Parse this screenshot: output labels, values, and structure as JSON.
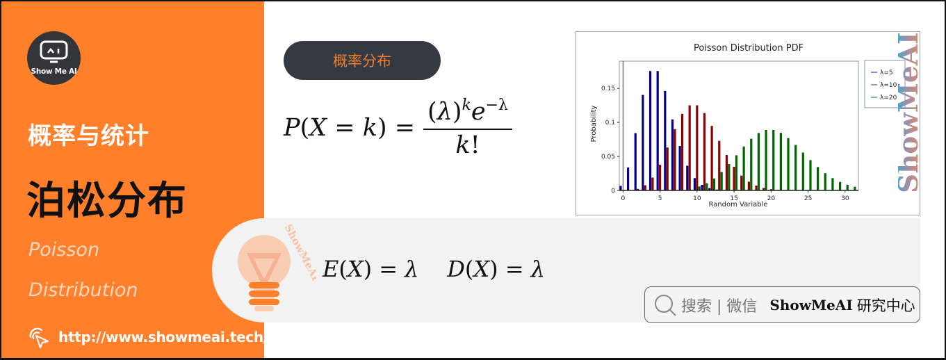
{
  "brand": {
    "logo_text": "Show Me AI",
    "logo_glyph": "^ I",
    "url": "http://www.showmeai.tech/",
    "watermark": "ShowMeAI"
  },
  "left_panel": {
    "subject": "概率与统计",
    "title_cn": "泊松分布",
    "title_en_line1": "Poisson",
    "title_en_line2": "Distribution"
  },
  "colors": {
    "orange": "#FF7F2A",
    "dark": "#343A44",
    "band_gray": "#F2F2F2",
    "lambda5": "#00008B",
    "lambda10": "#8B0000",
    "lambda20": "#006400"
  },
  "tag": {
    "label": "概率分布"
  },
  "formula": {
    "lhs": "P(X = k) =",
    "numerator_base": "(λ)",
    "numerator_exp_k": "k",
    "numerator_e": "e",
    "numerator_exp_lambda": "−λ",
    "denominator": "k!"
  },
  "moments": {
    "expectation": "E(X) = λ",
    "variance": "D(X) = λ"
  },
  "search": {
    "icon": "search-icon",
    "label": "搜索 | 微信",
    "brand": "ShowMeAI",
    "brand_suffix": "研究中心"
  },
  "chart_data": {
    "type": "bar",
    "title": "Poisson Distribution PDF",
    "xlabel": "Random Variable",
    "ylabel": "Probability",
    "xlim": [
      -0.5,
      31.8
    ],
    "ylim": [
      0,
      0.19
    ],
    "xticks": [
      "0",
      "5",
      "10",
      "15",
      "20",
      "25",
      "30"
    ],
    "xtick_values": [
      0,
      5,
      10,
      15,
      20,
      25,
      30
    ],
    "yticks": [
      "0",
      "0.05",
      "0.1",
      "0.15"
    ],
    "ytick_values": [
      0,
      0.05,
      0.1,
      0.15
    ],
    "legend_position": "right-outside-top",
    "categories": [
      0,
      1,
      2,
      3,
      4,
      5,
      6,
      7,
      8,
      9,
      10,
      11,
      12,
      13,
      14,
      15,
      16,
      17,
      18,
      19,
      20,
      21,
      22,
      23,
      24,
      25,
      26,
      27,
      28,
      29,
      30,
      31
    ],
    "series": [
      {
        "name": "λ=5",
        "color": "#00008B",
        "values": [
          0.0067,
          0.0337,
          0.0842,
          0.1404,
          0.1755,
          0.1755,
          0.1462,
          0.1044,
          0.0653,
          0.0363,
          0.0181,
          0.0082,
          0.0034,
          0.0013,
          0.0005,
          0.0002,
          0,
          0,
          0,
          0,
          0,
          0,
          0,
          0,
          0,
          0,
          0,
          0,
          0,
          0,
          0,
          0
        ]
      },
      {
        "name": "λ=10",
        "color": "#8B0000",
        "values": [
          0.0,
          0.0005,
          0.0023,
          0.0076,
          0.0189,
          0.0378,
          0.0631,
          0.0901,
          0.1126,
          0.1251,
          0.1251,
          0.1137,
          0.0948,
          0.0729,
          0.0521,
          0.0347,
          0.0217,
          0.0128,
          0.0071,
          0.0037,
          0.0019,
          0.0009,
          0.0004,
          0.0002,
          0.0001,
          0,
          0,
          0,
          0,
          0,
          0,
          0
        ]
      },
      {
        "name": "λ=20",
        "color": "#006400",
        "values": [
          0,
          0,
          0,
          0,
          0,
          0,
          0.0,
          0.0001,
          0.0004,
          0.001,
          0.0058,
          0.0106,
          0.0176,
          0.0271,
          0.0387,
          0.0516,
          0.0646,
          0.076,
          0.0844,
          0.0888,
          0.0888,
          0.0846,
          0.0769,
          0.0669,
          0.0557,
          0.0446,
          0.0343,
          0.0254,
          0.0181,
          0.0125,
          0.0083,
          0.0054
        ]
      }
    ]
  }
}
